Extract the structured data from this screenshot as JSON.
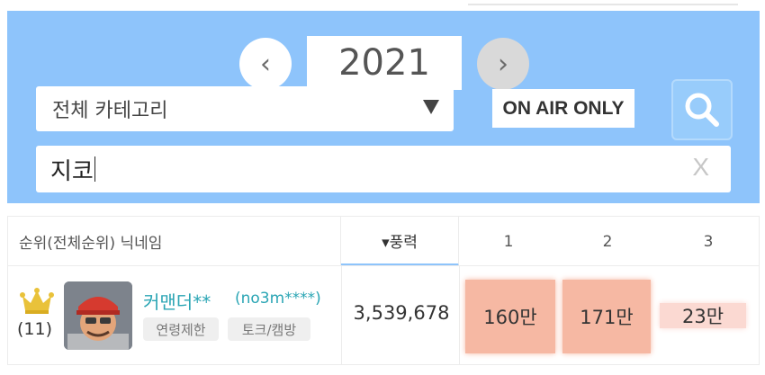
{
  "filters": {
    "prev_label": "‹",
    "year": "2021",
    "next_label": "›",
    "category": "전체 카테고리",
    "on_air_label": "ON AIR ONLY",
    "search_value": "지코",
    "clear_label": "X"
  },
  "table": {
    "headers": {
      "rank_nick": "순위(전체순위)  닉네임",
      "power": "▾풍력",
      "col1": "1",
      "col2": "2",
      "col3": "3"
    },
    "rows": [
      {
        "rank": "(11)",
        "nickname": "커맨더**",
        "user_id": "(no3m****)",
        "tags": [
          "연령제한",
          "토크/캠방"
        ],
        "power": "3,539,678",
        "values": [
          "160만",
          "171만",
          "23만"
        ]
      }
    ]
  },
  "colors": {
    "panel_bg": "#8ec4fb",
    "accent": "#2aa5b4",
    "highlight": "#f6b8a3"
  }
}
